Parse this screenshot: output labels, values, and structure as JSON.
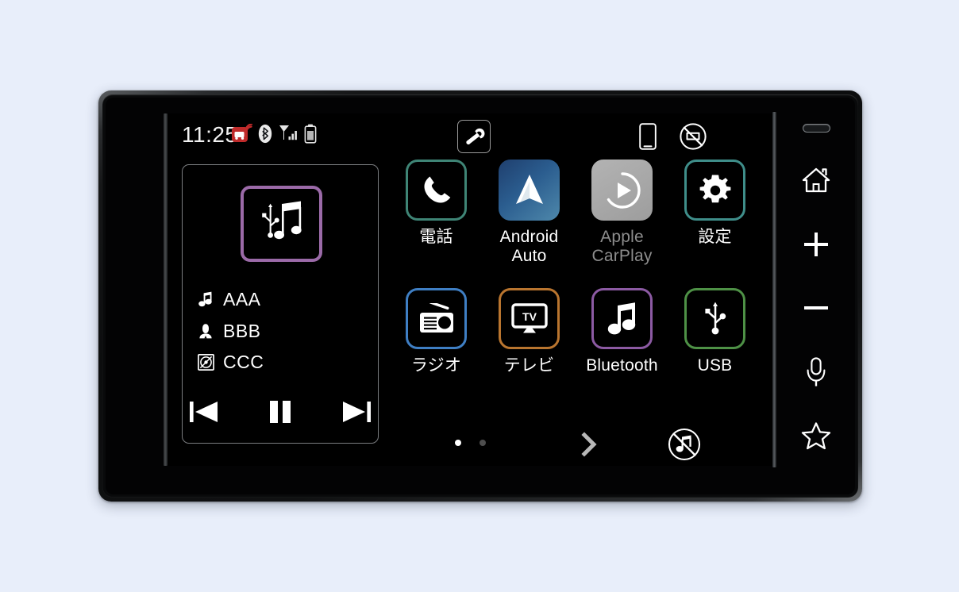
{
  "device": {
    "name": "car-audio-head-unit"
  },
  "screen": {
    "statusbar": {
      "clock": "11:25",
      "icons": [
        {
          "name": "vics-traffic-icon",
          "label": "VICS"
        },
        {
          "name": "bluetooth-icon",
          "label": "Bluetooth"
        },
        {
          "name": "signal-strength-icon",
          "label": "Signal"
        },
        {
          "name": "battery-icon",
          "label": "Battery"
        }
      ],
      "tools_button": {
        "name": "wrench-icon",
        "label": "Tools"
      },
      "right_icons": [
        {
          "name": "smartphone-icon",
          "label": "Smartphone"
        },
        {
          "name": "no-device-icon",
          "label": "No device"
        }
      ]
    },
    "media_panel": {
      "source_icon": "usb-music-icon",
      "source_accent": "#9b6aa8",
      "meta": [
        {
          "icon": "music-note-icon",
          "text": "AAA"
        },
        {
          "icon": "artist-icon",
          "text": "BBB"
        },
        {
          "icon": "album-disc-icon",
          "text": "CCC"
        }
      ],
      "transport": [
        {
          "name": "previous-track-button",
          "label": "Previous"
        },
        {
          "name": "pause-button",
          "label": "Pause"
        },
        {
          "name": "next-track-button",
          "label": "Next"
        }
      ]
    },
    "apps": {
      "rows": [
        [
          {
            "name": "app-phone",
            "label": "電話",
            "icon": "phone-handset-icon",
            "accent": "#3f8576",
            "style": "outline",
            "disabled": false
          },
          {
            "name": "app-android-auto",
            "label": "Android\nAuto",
            "icon": "android-auto-icon",
            "accent": "#2b5d8f",
            "style": "filled",
            "disabled": false
          },
          {
            "name": "app-apple-carplay",
            "label": "Apple\nCarPlay",
            "icon": "carplay-icon",
            "accent": "#a8a8a8",
            "style": "filled",
            "disabled": true
          },
          {
            "name": "app-settings",
            "label": "設定",
            "icon": "gear-icon",
            "accent": "#3f8e8a",
            "style": "outline",
            "disabled": false
          }
        ],
        [
          {
            "name": "app-radio",
            "label": "ラジオ",
            "icon": "radio-icon",
            "accent": "#3f7fc4",
            "style": "outline",
            "disabled": false
          },
          {
            "name": "app-tv",
            "label": "テレビ",
            "icon": "tv-icon",
            "accent": "#b9752f",
            "style": "outline",
            "disabled": false
          },
          {
            "name": "app-bluetooth",
            "label": "Bluetooth",
            "icon": "music-note-icon",
            "accent": "#8c5aa3",
            "style": "outline",
            "disabled": false
          },
          {
            "name": "app-usb",
            "label": "USB",
            "icon": "usb-icon",
            "accent": "#4e9146",
            "style": "outline",
            "disabled": false
          }
        ]
      ]
    },
    "bottombar": {
      "page_dots": {
        "total": 2,
        "active_index": 0
      },
      "next_page": {
        "name": "next-page-button",
        "label": "Next page"
      },
      "mute": {
        "name": "audio-off-icon",
        "label": "Audio off"
      }
    }
  },
  "hardware_buttons": [
    {
      "name": "sensor-window",
      "label": "Sensor"
    },
    {
      "name": "home-button",
      "label": "Home"
    },
    {
      "name": "volume-up-button",
      "label": "Volume up"
    },
    {
      "name": "volume-down-button",
      "label": "Volume down"
    },
    {
      "name": "voice-button",
      "label": "Voice"
    },
    {
      "name": "favorite-button",
      "label": "Favorite"
    }
  ]
}
